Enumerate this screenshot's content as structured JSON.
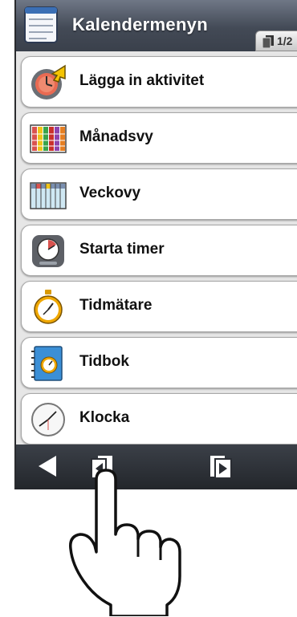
{
  "header": {
    "title": "Kalendermenyn",
    "page_indicator": "1/2",
    "icon": "calendar-list-icon"
  },
  "menu": {
    "items": [
      {
        "label": "Lägga in aktivitet",
        "icon": "add-activity-clock-icon"
      },
      {
        "label": "Månadsvy",
        "icon": "month-view-icon"
      },
      {
        "label": "Veckovy",
        "icon": "week-view-icon"
      },
      {
        "label": "Starta timer",
        "icon": "timer-icon"
      },
      {
        "label": "Tidmätare",
        "icon": "stopwatch-icon"
      },
      {
        "label": "Tidbok",
        "icon": "timebook-icon"
      },
      {
        "label": "Klocka",
        "icon": "clock-icon"
      }
    ]
  },
  "bottom_bar": {
    "back": "back-arrow-icon",
    "prev_page": "previous-page-icon",
    "next_page": "next-page-icon"
  },
  "overlay": {
    "hand": "pointing-hand-icon"
  },
  "colors": {
    "header": "#434a56",
    "menu_bg": "#e6e6e6",
    "bar": "#2a2d33",
    "arrow_yellow": "#f5c400"
  }
}
